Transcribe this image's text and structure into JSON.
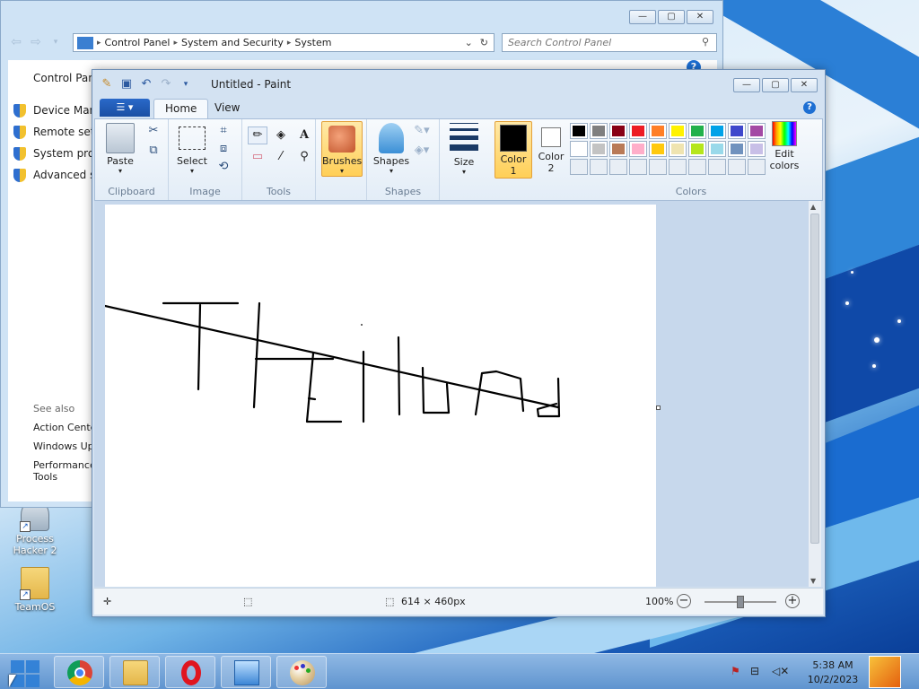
{
  "desktop": {
    "icons": [
      {
        "label_line1": "Process",
        "label_line2": "Hacker 2"
      },
      {
        "label_line1": "TeamOS",
        "label_line2": ""
      }
    ]
  },
  "control_panel": {
    "breadcrumb": [
      "Control Panel",
      "System and Security",
      "System"
    ],
    "search_placeholder": "Search Control Panel",
    "sidebar": {
      "home": "Control Pane",
      "items": [
        "Device Mana",
        "Remote settir",
        "System prote",
        "Advanced sys"
      ],
      "see_also_title": "See also",
      "see_also": [
        "Action Cente",
        "Windows Up",
        "Performance",
        "Tools"
      ]
    }
  },
  "paint": {
    "title": "Untitled - Paint",
    "tabs": {
      "home": "Home",
      "view": "View"
    },
    "ribbon": {
      "clipboard": {
        "paste": "Paste",
        "label": "Clipboard"
      },
      "image": {
        "select": "Select",
        "label": "Image"
      },
      "tools": {
        "label": "Tools"
      },
      "brushes": "Brushes",
      "shapes": {
        "shapes": "Shapes",
        "label": "Shapes"
      },
      "size": "Size",
      "color1_line1": "Color",
      "color1_line2": "1",
      "color2_line1": "Color",
      "color2_line2": "2",
      "colors_label": "Colors",
      "edit_colors_line1": "Edit",
      "edit_colors_line2": "colors",
      "color1_value": "#000000",
      "color2_value": "#ffffff"
    },
    "palette": [
      "#000000",
      "#7f7f7f",
      "#880015",
      "#ed1c24",
      "#ff7f27",
      "#fff200",
      "#22b14c",
      "#00a2e8",
      "#3f48cc",
      "#a349a4",
      "#ffffff",
      "#c3c3c3",
      "#b97a57",
      "#ffaec9",
      "#ffc90e",
      "#efe4b0",
      "#b5e61d",
      "#99d9ea",
      "#7092be",
      "#c8bfe7"
    ],
    "status": {
      "dimensions": "614 × 460px",
      "zoom": "100%"
    }
  },
  "taskbar": {
    "time": "5:38 AM",
    "date": "10/2/2023"
  }
}
